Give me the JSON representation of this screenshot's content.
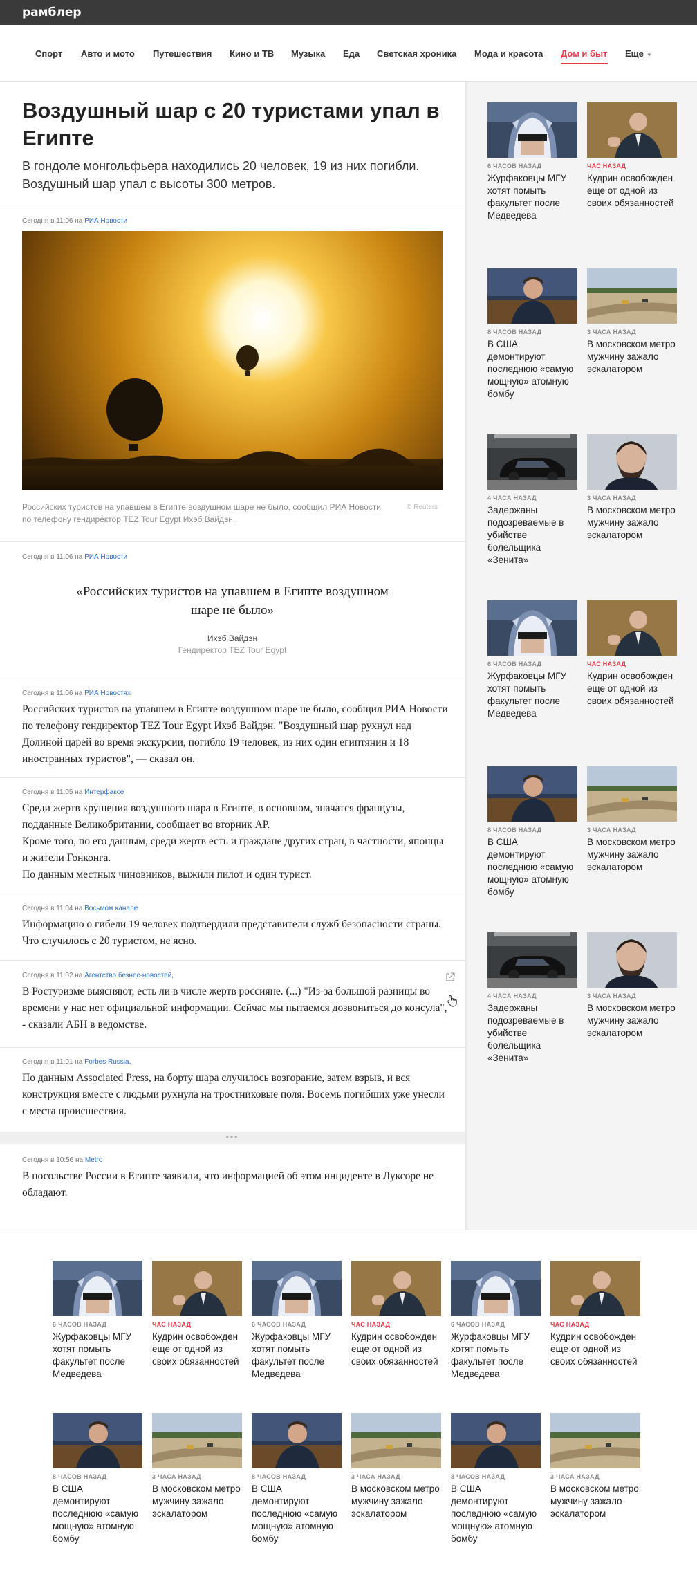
{
  "header": {
    "logo": "рамблер"
  },
  "nav": {
    "items": [
      "Спорт",
      "Авто и мото",
      "Путешествия",
      "Кино и ТВ",
      "Музыка",
      "Еда",
      "Светская хроника",
      "Мода и красота",
      "Дом и быт",
      "Еще"
    ],
    "active": "Дом и быт"
  },
  "article": {
    "title": "Воздушный шар с 20 туристами упал в Египте",
    "lead": "В гондоле монгольфьера находились 20 человек, 19 из них погибли. Воздушный шар упал с высоты 300 метров.",
    "photo": {
      "meta_time": "Сегодня в 11:06 на ",
      "meta_source": "РИА Новости",
      "caption": "Российских туристов на упавшем в Египте воздушном шаре не было, сообщил РИА Новости по телефону гендиректор TEZ Tour Egypt Ихэб Вайдэн.",
      "credit": "© Reuters"
    },
    "quote": {
      "meta_time": "Сегодня в 11:06 на ",
      "meta_source": "РИА Новости",
      "text": "«Российских туристов на упавшем в Египте воздушном шаре не было»",
      "author": "Ихэб Вайдэн",
      "role": "Гендиректор TEZ Tour Egypt"
    },
    "entries": [
      {
        "time": "Сегодня в 11:06 на ",
        "source": "РИА Новостях",
        "text": "Российских туристов на упавшем в Египте воздушном шаре не было, сообщил РИА Новости по телефону гендиректор TEZ Tour Egypt Ихэб Вайдэн. \"Воздушный шар рухнул над Долиной царей во время экскурсии, погибло 19 человек, из них один египтянин и 18 иностранных туристов\", — сказал он."
      },
      {
        "time": "Сегодня в 11:05 на ",
        "source": "Интерфаксе",
        "text": "Среди жертв крушения воздушного шара в Египте, в основном, значатся французы, подданные Великобритании, сообщает во вторник АР.\nКроме того, по его данным, среди жертв есть и граждане других стран, в частности, японцы и жители Гонконга.\nПо данным местных чиновников, выжили пилот и один турист."
      },
      {
        "time": "Сегодня в 11:04 на ",
        "source": "Восьмом канале",
        "text": "Информацию о гибели 19 человек подтвердили представители служб безопасности страны. Что случилось с 20 туристом, не ясно."
      },
      {
        "time": "Сегодня в 11:02 на ",
        "source": "Агентство безнес-новостей,",
        "text": "В Ростуризме выясняют, есть ли в числе жертв россияне. (...) \"Из-за большой разницы во времени у нас нет официальной информации. Сейчас мы пытаемся дозвониться до консула\", - сказали АБН в ведомстве."
      },
      {
        "time": "Сегодня в 11:01 на ",
        "source": "Forbes Russia,",
        "text": "По данным Associated Press, на борту шара случилось возгорание, затем взрыв, и вся конструкция вместе с людьми рухнула на тростниковые поля. Восемь погибших уже унесли с места происшествия."
      },
      {
        "time": "Сегодня в 10:56 на ",
        "source": "Metro",
        "text": "В посольстве России в Египте заявили, что информацией об этом инциденте в Луксоре не обладают."
      }
    ],
    "expand_label": "•••"
  },
  "sidebar": {
    "cards": [
      {
        "time": "6 ЧАСОВ НАЗАД",
        "red": false,
        "title": "Журфаковцы МГУ хотят помыть факультет после Медведева",
        "img": "hood"
      },
      {
        "time": "ЧАС НАЗАД",
        "red": true,
        "title": "Кудрин освобожден еще от одной из своих обязанностей",
        "img": "suit"
      },
      {
        "time": "8 ЧАСОВ НАЗАД",
        "red": false,
        "title": "В США демонтируют последнюю «самую мощную» атомную бомбу",
        "img": "man"
      },
      {
        "time": "3 ЧАСА НАЗАД",
        "red": false,
        "title": "В московском метро мужчину зажало эскалатором",
        "img": "road"
      },
      {
        "time": "4 ЧАСА НАЗАД",
        "red": false,
        "title": "Задержаны подозреваемые в убийстве болельщика «Зенита»",
        "img": "car"
      },
      {
        "time": "3 ЧАСА НАЗАД",
        "red": false,
        "title": "В московском метро мужчину зажало эскалатором",
        "img": "beard"
      },
      {
        "time": "6 ЧАСОВ НАЗАД",
        "red": false,
        "title": "Журфаковцы МГУ хотят помыть факультет после Медведева",
        "img": "hood"
      },
      {
        "time": "ЧАС НАЗАД",
        "red": true,
        "title": "Кудрин освобожден еще от одной из своих обязанностей",
        "img": "suit"
      },
      {
        "time": "8 ЧАСОВ НАЗАД",
        "red": false,
        "title": "В США демонтируют последнюю «самую мощную» атомную бомбу",
        "img": "man"
      },
      {
        "time": "3 ЧАСА НАЗАД",
        "red": false,
        "title": "В московском метро мужчину зажало эскалатором",
        "img": "road"
      },
      {
        "time": "4 ЧАСА НАЗАД",
        "red": false,
        "title": "Задержаны подозреваемые в убийстве болельщика «Зенита»",
        "img": "car"
      },
      {
        "time": "3 ЧАСА НАЗАД",
        "red": false,
        "title": "В московском метро мужчину зажало эскалатором",
        "img": "beard"
      }
    ]
  },
  "bottom": {
    "cards": [
      {
        "time": "6 ЧАСОВ НАЗАД",
        "red": false,
        "title": "Журфаковцы МГУ хотят помыть факультет после Медведева",
        "img": "hood"
      },
      {
        "time": "ЧАС НАЗАД",
        "red": true,
        "title": "Кудрин освобожден еще от одной из своих обязанностей",
        "img": "suit"
      },
      {
        "time": "6 ЧАСОВ НАЗАД",
        "red": false,
        "title": "Журфаковцы МГУ хотят помыть факультет после Медведева",
        "img": "hood"
      },
      {
        "time": "ЧАС НАЗАД",
        "red": true,
        "title": "Кудрин освобожден еще от одной из своих обязанностей",
        "img": "suit"
      },
      {
        "time": "6 ЧАСОВ НАЗАД",
        "red": false,
        "title": "Журфаковцы МГУ хотят помыть факультет после Медведева",
        "img": "hood"
      },
      {
        "time": "ЧАС НАЗАД",
        "red": true,
        "title": "Кудрин освобожден еще от одной из своих обязанностей",
        "img": "suit"
      },
      {
        "time": "8 ЧАСОВ НАЗАД",
        "red": false,
        "title": "В США демонтируют последнюю «самую мощную» атомную бомбу",
        "img": "man"
      },
      {
        "time": "3 ЧАСА НАЗАД",
        "red": false,
        "title": "В московском метро мужчину зажало эскалатором",
        "img": "road"
      },
      {
        "time": "8 ЧАСОВ НАЗАД",
        "red": false,
        "title": "В США демонтируют последнюю «самую мощную» атомную бомбу",
        "img": "man"
      },
      {
        "time": "3 ЧАСА НАЗАД",
        "red": false,
        "title": "В московском метро мужчину зажало эскалатором",
        "img": "road"
      },
      {
        "time": "8 ЧАСОВ НАЗАД",
        "red": false,
        "title": "В США демонтируют последнюю «самую мощную» атомную бомбу",
        "img": "man"
      },
      {
        "time": "3 ЧАСА НАЗАД",
        "red": false,
        "title": "В московском метро мужчину зажало эскалатором",
        "img": "road"
      }
    ]
  },
  "colors": {
    "accent": "#e63a4b",
    "link": "#2a6fd1",
    "topbar": "#3a3a3a"
  }
}
